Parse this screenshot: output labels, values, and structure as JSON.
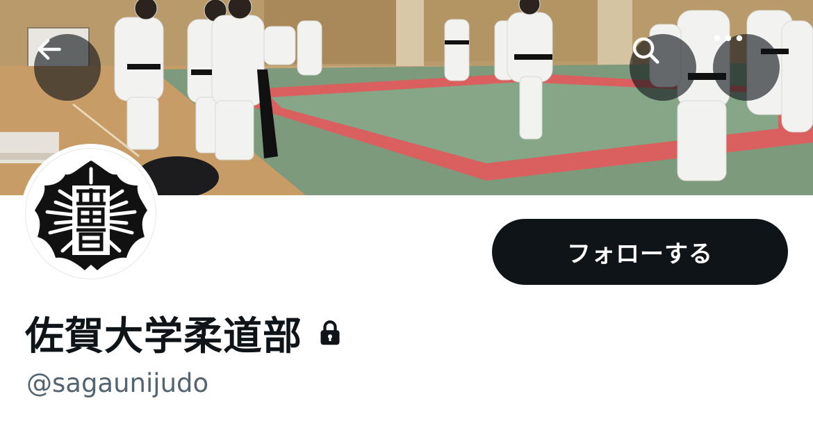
{
  "header": {
    "back_icon": "arrow-left-icon",
    "search_icon": "search-icon",
    "more_icon": "more-horizontal-icon"
  },
  "profile": {
    "display_name": "佐賀大学柔道部",
    "handle": "@sagaunijudo",
    "protected_icon": "lock-icon",
    "avatar_icon": "saga-university-emblem"
  },
  "actions": {
    "follow_label": "フォローする"
  },
  "colors": {
    "text_primary": "#0f1419",
    "text_secondary": "#536471",
    "follow_button_bg": "#0f1419",
    "follow_button_text": "#ffffff"
  }
}
